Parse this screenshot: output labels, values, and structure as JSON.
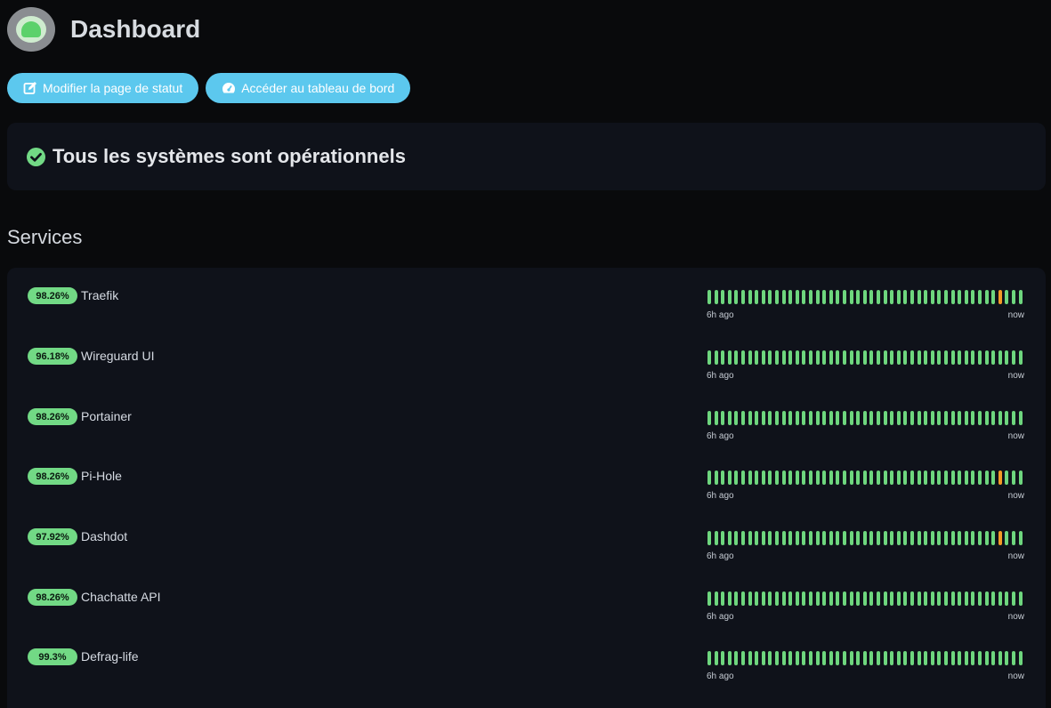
{
  "header": {
    "title": "Dashboard",
    "logo": "uptime-kuma-logo"
  },
  "toolbar": {
    "edit_label": "Modifier la page de statut",
    "edit_icon": "edit-icon",
    "dashboard_label": "Accéder au tableau de bord",
    "dashboard_icon": "gauge-icon"
  },
  "status": {
    "text": "Tous les systèmes sont opérationnels",
    "icon": "check-circle-icon"
  },
  "services": {
    "title": "Services",
    "beats_count": 47,
    "start_label": "6h ago",
    "end_label": "now",
    "items": [
      {
        "uptime": "98.26%",
        "name": "Traefik",
        "warn_beats": [
          43
        ]
      },
      {
        "uptime": "96.18%",
        "name": "Wireguard UI",
        "warn_beats": []
      },
      {
        "uptime": "98.26%",
        "name": "Portainer",
        "warn_beats": []
      },
      {
        "uptime": "98.26%",
        "name": "Pi-Hole",
        "warn_beats": [
          43
        ]
      },
      {
        "uptime": "97.92%",
        "name": "Dashdot",
        "warn_beats": [
          43
        ]
      },
      {
        "uptime": "98.26%",
        "name": "Chachatte API",
        "warn_beats": []
      },
      {
        "uptime": "99.3%",
        "name": "Defrag-life",
        "warn_beats": []
      }
    ]
  },
  "colors": {
    "accent": "#5cc8ee",
    "up": "#6ed67e",
    "warn": "#f39c26",
    "card": "#0f121a",
    "bg": "#090a0c"
  }
}
